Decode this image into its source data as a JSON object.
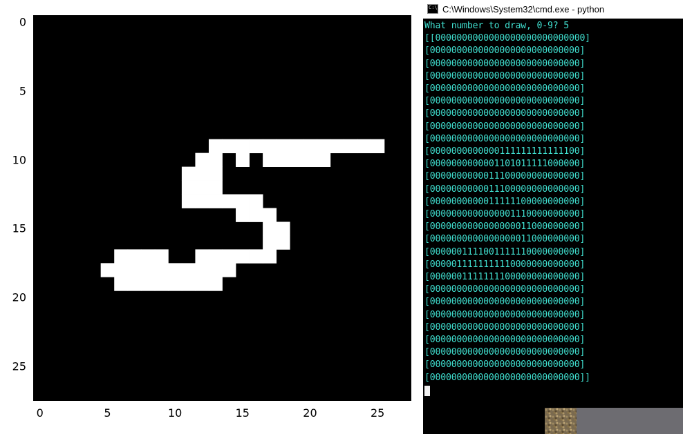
{
  "plot": {
    "x_ticks": [
      "0",
      "5",
      "10",
      "15",
      "20",
      "25"
    ],
    "y_ticks": [
      "0",
      "5",
      "10",
      "15",
      "20",
      "25"
    ],
    "x_range": [
      -0.5,
      27.5
    ],
    "y_range": [
      -0.5,
      27.5
    ]
  },
  "console": {
    "title": "C:\\Windows\\System32\\cmd.exe - python",
    "prompt": "What number to draw, 0-9? ",
    "input": "5",
    "matrix_prefix": "[",
    "matrix_suffix": "]",
    "rows": [
      "0000000000000000000000000000",
      "0000000000000000000000000000",
      "0000000000000000000000000000",
      "0000000000000000000000000000",
      "0000000000000000000000000000",
      "0000000000000000000000000000",
      "0000000000000000000000000000",
      "0000000000000000000000000000",
      "0000000000000000000000000000",
      "0000000000000111111111111100",
      "0000000000001101011111000000",
      "0000000000011100000000000000",
      "0000000000011100000000000000",
      "0000000000011111100000000000",
      "0000000000000001110000000000",
      "0000000000000000011000000000",
      "0000000000000000011000000000",
      "0000001111001111110000000000",
      "0000011111111110000000000000",
      "0000001111111100000000000000",
      "0000000000000000000000000000",
      "0000000000000000000000000000",
      "0000000000000000000000000000",
      "0000000000000000000000000000",
      "0000000000000000000000000000",
      "0000000000000000000000000000",
      "0000000000000000000000000000",
      "0000000000000000000000000000"
    ]
  },
  "chart_data": {
    "type": "heatmap",
    "title": "",
    "xlabel": "",
    "ylabel": "",
    "x_range": [
      0,
      27
    ],
    "y_range": [
      0,
      27
    ],
    "description": "28x28 binary pixel grid depicting a handwritten digit 5 (MNIST-style). White=1, black=0. Origin at top-left, y increases downward.",
    "grid": [
      "0000000000000000000000000000",
      "0000000000000000000000000000",
      "0000000000000000000000000000",
      "0000000000000000000000000000",
      "0000000000000000000000000000",
      "0000000000000000000000000000",
      "0000000000000000000000000000",
      "0000000000000000000000000000",
      "0000000000000000000000000000",
      "0000000000000111111111111100",
      "0000000000001101011111000000",
      "0000000000011100000000000000",
      "0000000000011100000000000000",
      "0000000000011111100000000000",
      "0000000000000001110000000000",
      "0000000000000000011000000000",
      "0000000000000000011000000000",
      "0000001111001111110000000000",
      "0000011111111110000000000000",
      "0000001111111100000000000000",
      "0000000000000000000000000000",
      "0000000000000000000000000000",
      "0000000000000000000000000000",
      "0000000000000000000000000000",
      "0000000000000000000000000000",
      "0000000000000000000000000000",
      "0000000000000000000000000000",
      "0000000000000000000000000000"
    ]
  }
}
